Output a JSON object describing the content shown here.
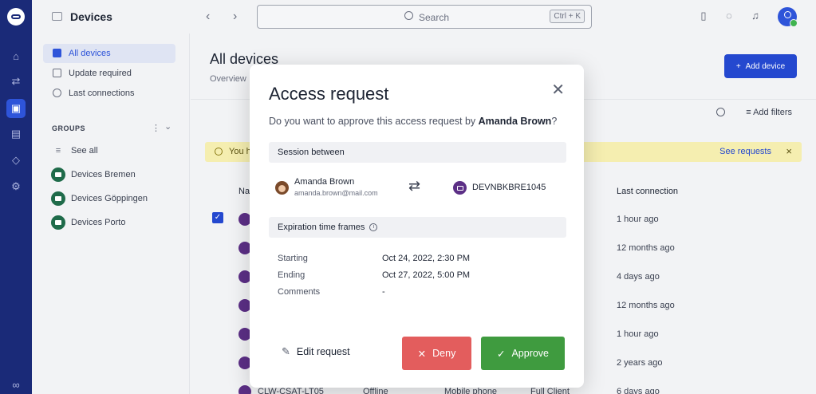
{
  "app": {
    "section_title": "Devices",
    "search": {
      "placeholder": "Search",
      "shortcut": "Ctrl + K"
    }
  },
  "rail": {
    "items": [
      "home-icon",
      "transfer-icon",
      "devices-icon",
      "sessions-icon",
      "tag-icon",
      "settings-icon",
      "link-icon"
    ]
  },
  "sidebar": {
    "items": [
      {
        "label": "All devices",
        "icon": "devices-icon"
      },
      {
        "label": "Update required",
        "icon": "update-icon"
      },
      {
        "label": "Last connections",
        "icon": "clock-icon"
      }
    ],
    "groups_header": "GROUPS",
    "see_all": "See all",
    "groups": [
      {
        "label": "Devices Bremen"
      },
      {
        "label": "Devices Göppingen"
      },
      {
        "label": "Devices Porto"
      }
    ]
  },
  "main": {
    "title": "All devices",
    "subtitle": "Overview",
    "add_device_label": "Add device",
    "add_filters_label": "Add filters",
    "banner": {
      "text": "You h",
      "link": "See requests"
    },
    "columns": {
      "name": "Na",
      "last_connection": "Last connection"
    },
    "last_connections": [
      "1 hour ago",
      "12 months ago",
      "4 days ago",
      "12 months ago",
      "1 hour ago",
      "2 years ago",
      "6 days ago"
    ],
    "bottom_row": {
      "name": "CLW-CSAT-LT05",
      "status": "Offline",
      "type": "Mobile phone",
      "client": "Full Client"
    }
  },
  "modal": {
    "title": "Access request",
    "question_prefix": "Do you want to approve this access request by ",
    "question_name": "Amanda Brown",
    "question_suffix": "?",
    "session_header": "Session between",
    "requester": {
      "name": "Amanda Brown",
      "email": "amanda.brown@mail.com"
    },
    "device_name": "DEVNBKBRE1045",
    "expiration_header": "Expiration time frames",
    "fields": [
      {
        "label": "Starting",
        "value": "Oct 24, 2022, 2:30 PM"
      },
      {
        "label": "Ending",
        "value": "Oct 27, 2022, 5:00 PM"
      },
      {
        "label": "Comments",
        "value": "-"
      }
    ],
    "edit_label": "Edit request",
    "deny_label": "Deny",
    "approve_label": "Approve"
  },
  "colors": {
    "rail": "#1a2a78",
    "accent": "#2448cf",
    "deny": "#e35d5d",
    "approve": "#3f9b3f",
    "banner": "#f5eeb0",
    "device_purple": "#5c2f86",
    "group_green": "#1f6b4a"
  }
}
